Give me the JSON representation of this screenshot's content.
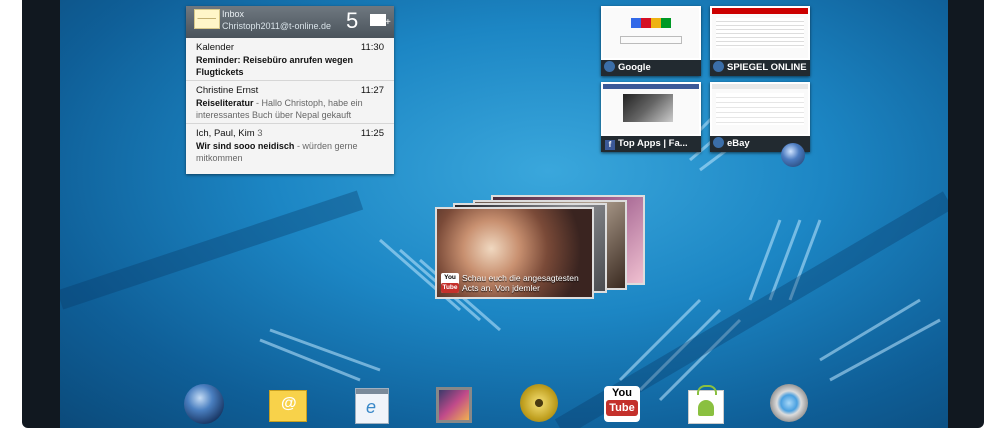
{
  "email_widget": {
    "title": "Inbox",
    "account": "Christoph2011@t-online.de",
    "unread_count": "5",
    "messages": [
      {
        "from": "Kalender",
        "time": "11:30",
        "subject": "Reminder: Reisebüro anrufen wegen Flugtickets",
        "snippet": ""
      },
      {
        "from": "Christine Ernst",
        "time": "11:27",
        "subject": "Reiseliteratur",
        "snippet": " - Hallo Christoph, habe ein interessantes Buch über Nepal gekauft"
      },
      {
        "from": "Ich, Paul, Kim",
        "count": "3",
        "time": "11:25",
        "subject": "Wir sind sooo neidisch",
        "snippet": " - würden gerne mitkommen"
      }
    ]
  },
  "bookmarks": [
    {
      "label": "Google",
      "icon": "globe-icon"
    },
    {
      "label": "SPIEGEL ONLINE",
      "icon": "globe-icon"
    },
    {
      "label": "Top Apps | Fa...",
      "icon": "facebook-icon"
    },
    {
      "label": "eBay",
      "icon": "globe-icon"
    }
  ],
  "youtube_widget": {
    "caption_line1": "Schau euch die angesagtesten",
    "caption_line2": "Acts an. Von jdemler",
    "logo_top": "You",
    "logo_bottom": "Tube"
  },
  "dock": {
    "youtube_you": "You",
    "youtube_tube": "Tube",
    "icons": [
      "browser-globe-icon",
      "email-icon",
      "notes-icon",
      "gallery-icon",
      "music-icon",
      "youtube-icon",
      "market-icon",
      "camera-icon"
    ]
  }
}
